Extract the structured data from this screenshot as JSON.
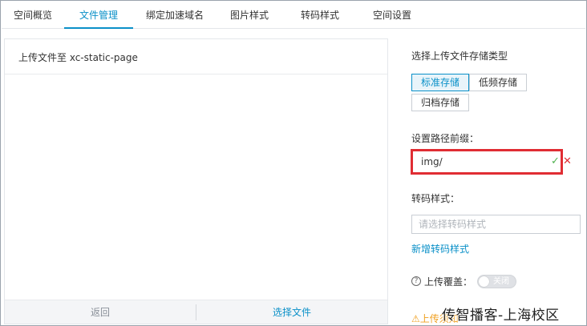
{
  "tabs": [
    {
      "label": "空间概览"
    },
    {
      "label": "文件管理"
    },
    {
      "label": "绑定加速域名"
    },
    {
      "label": "图片样式"
    },
    {
      "label": "转码样式"
    },
    {
      "label": "空间设置"
    }
  ],
  "active_tab": "文件管理",
  "left": {
    "header": "上传文件至 xc-static-page",
    "back_label": "返回",
    "select_label": "选择文件"
  },
  "right": {
    "storage_title": "选择上传文件存储类型",
    "storage_options": [
      "标准存储",
      "低频存储",
      "归档存储"
    ],
    "selected_storage": "标准存储",
    "prefix_label": "设置路径前缀：",
    "prefix_value": "img/",
    "confirm_glyph": "✓",
    "cancel_glyph": "✕",
    "transcode_label": "转码样式：",
    "transcode_placeholder": "请选择转码样式",
    "add_transcode_link": "新增转码样式",
    "overwrite_help_glyph": "?",
    "overwrite_label": "上传覆盖：",
    "overwrite_toggle_text": "关闭",
    "overwrite_enabled": false,
    "notice_label": "⚠上传须知"
  },
  "watermark": "传智播客-上海校区",
  "colors": {
    "accent": "#0a90c8",
    "highlight_border": "#e02d33",
    "confirm": "#52b352",
    "warn": "#f0a020"
  },
  "icons": {
    "confirm": "check-icon",
    "cancel": "close-icon",
    "help": "question-circle-icon"
  }
}
